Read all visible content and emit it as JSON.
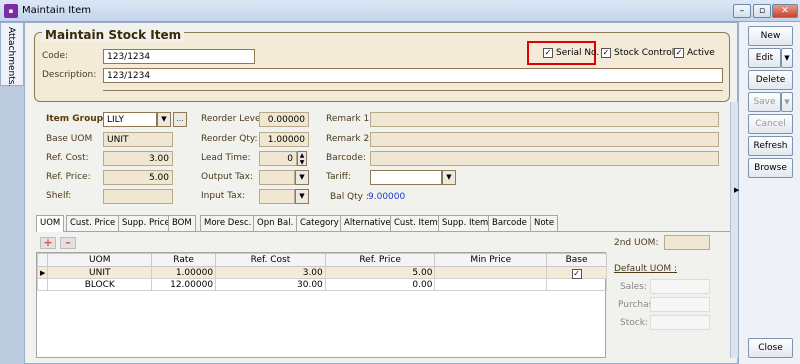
{
  "window": {
    "title": "Maintain Item",
    "app_icon": "sql-icon"
  },
  "side_tab": {
    "label": "Attachments..."
  },
  "header": {
    "title": "Maintain Stock Item",
    "code_label": "Code:",
    "code_value": "123/1234",
    "desc_label": "Description:",
    "desc_value": "123/1234",
    "serial_no": "Serial No.",
    "stock_control": "Stock Control",
    "active": "Active"
  },
  "fields": {
    "item_group_label": "Item Group:",
    "item_group_value": "LILY",
    "base_uom_label": "Base UOM",
    "base_uom_value": "UNIT",
    "ref_cost_label": "Ref. Cost:",
    "ref_cost_value": "3.00",
    "ref_price_label": "Ref. Price:",
    "ref_price_value": "5.00",
    "shelf_label": "Shelf:",
    "reorder_level_label": "Reorder Level:",
    "reorder_level_value": "0.00000",
    "reorder_qty_label": "Reorder Qty:",
    "reorder_qty_value": "1.00000",
    "lead_time_label": "Lead Time:",
    "lead_time_value": "0",
    "output_tax_label": "Output Tax:",
    "input_tax_label": "Input Tax:",
    "remark1_label": "Remark 1:",
    "remark2_label": "Remark 2:",
    "barcode_label": "Barcode:",
    "tariff_label": "Tariff:",
    "bal_qty_label": "Bal Qty :",
    "bal_qty_value": "9.00000"
  },
  "tabs": [
    "UOM",
    "Cust. Price",
    "Supp. Price",
    "BOM",
    "More Desc.",
    "Opn Bal.",
    "Category",
    "Alternative",
    "Cust. Item",
    "Supp. Item",
    "Barcode",
    "Note"
  ],
  "grid": {
    "columns": [
      "UOM",
      "Rate",
      "Ref. Cost",
      "Ref. Price",
      "Min Price",
      "Base"
    ],
    "rows": [
      {
        "uom": "UNIT",
        "rate": "1.00000",
        "cost": "3.00",
        "price": "5.00",
        "min": "",
        "base": true
      },
      {
        "uom": "BLOCK",
        "rate": "12.00000",
        "cost": "30.00",
        "price": "0.00",
        "min": "",
        "base": false
      }
    ]
  },
  "uom_panel": {
    "second_uom_label": "2nd UOM:",
    "default_uom_label": "Default UOM :",
    "sales_label": "Sales:",
    "purchase_label": "Purchase:",
    "stock_label": "Stock:"
  },
  "buttons": {
    "new": "New",
    "edit": "Edit",
    "delete": "Delete",
    "save": "Save",
    "cancel": "Cancel",
    "refresh": "Refresh",
    "browse": "Browse",
    "close": "Close"
  }
}
